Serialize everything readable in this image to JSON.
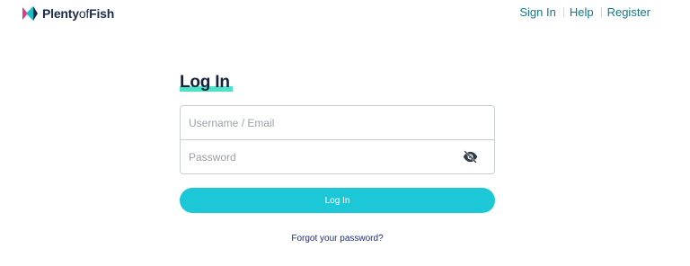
{
  "brand": {
    "name_bold_1": "Plenty",
    "name_light": "of",
    "name_bold_2": "Fish",
    "logo_icon": "fish-logo-icon",
    "colors": {
      "pink": "#e43a8c",
      "teal": "#16c0c8",
      "navy": "#1b2b4b"
    }
  },
  "nav": {
    "sign_in": "Sign In",
    "help": "Help",
    "register": "Register",
    "color": "#0f7a86"
  },
  "login": {
    "title": "Log In",
    "title_highlight_color": "#4de3c8",
    "username_placeholder": "Username / Email",
    "username_value": "",
    "password_placeholder": "Password",
    "password_value": "",
    "password_toggle_icon": "eye-off-icon",
    "submit_label": "Log In",
    "button_color": "#1cc8d8",
    "forgot_label": "Forgot your password?"
  }
}
